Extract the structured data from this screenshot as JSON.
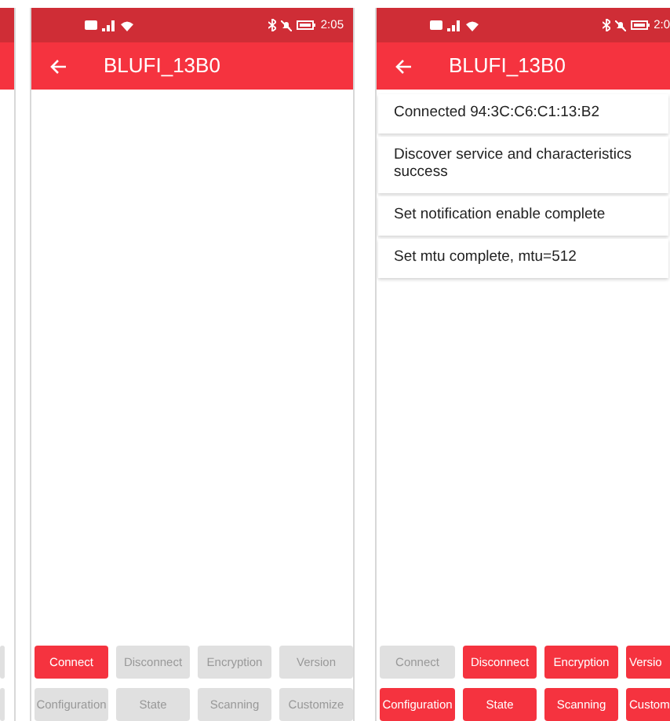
{
  "screens": [
    {
      "kind": "edge",
      "buttons": [
        {
          "enabled": false
        },
        {
          "enabled": false
        }
      ]
    },
    {
      "kind": "full",
      "status_bar": {
        "time": "2:05"
      },
      "title": "BLUFI_13B0",
      "buttons": [
        {
          "label": "Connect",
          "enabled": true
        },
        {
          "label": "Disconnect",
          "enabled": false
        },
        {
          "label": "Encryption",
          "enabled": false
        },
        {
          "label": "Version",
          "enabled": false
        },
        {
          "label": "Configuration",
          "enabled": false
        },
        {
          "label": "State",
          "enabled": false
        },
        {
          "label": "Scanning",
          "enabled": false
        },
        {
          "label": "Customize",
          "enabled": false
        }
      ]
    },
    {
      "kind": "cut",
      "status_bar": {
        "time": "2:0"
      },
      "title": "BLUFI_13B0",
      "messages": [
        "Connected 94:3C:C6:C1:13:B2",
        "Discover service and characteristics success",
        "Set notification enable  complete",
        "Set mtu complete, mtu=512"
      ],
      "buttons": [
        {
          "label": "Connect",
          "enabled": false
        },
        {
          "label": "Disconnect",
          "enabled": true
        },
        {
          "label": "Encryption",
          "enabled": true
        },
        {
          "label": "Versio",
          "enabled": true
        },
        {
          "label": "Configuration",
          "enabled": true
        },
        {
          "label": "State",
          "enabled": true
        },
        {
          "label": "Scanning",
          "enabled": true
        },
        {
          "label": "Custom",
          "enabled": true
        }
      ]
    }
  ]
}
